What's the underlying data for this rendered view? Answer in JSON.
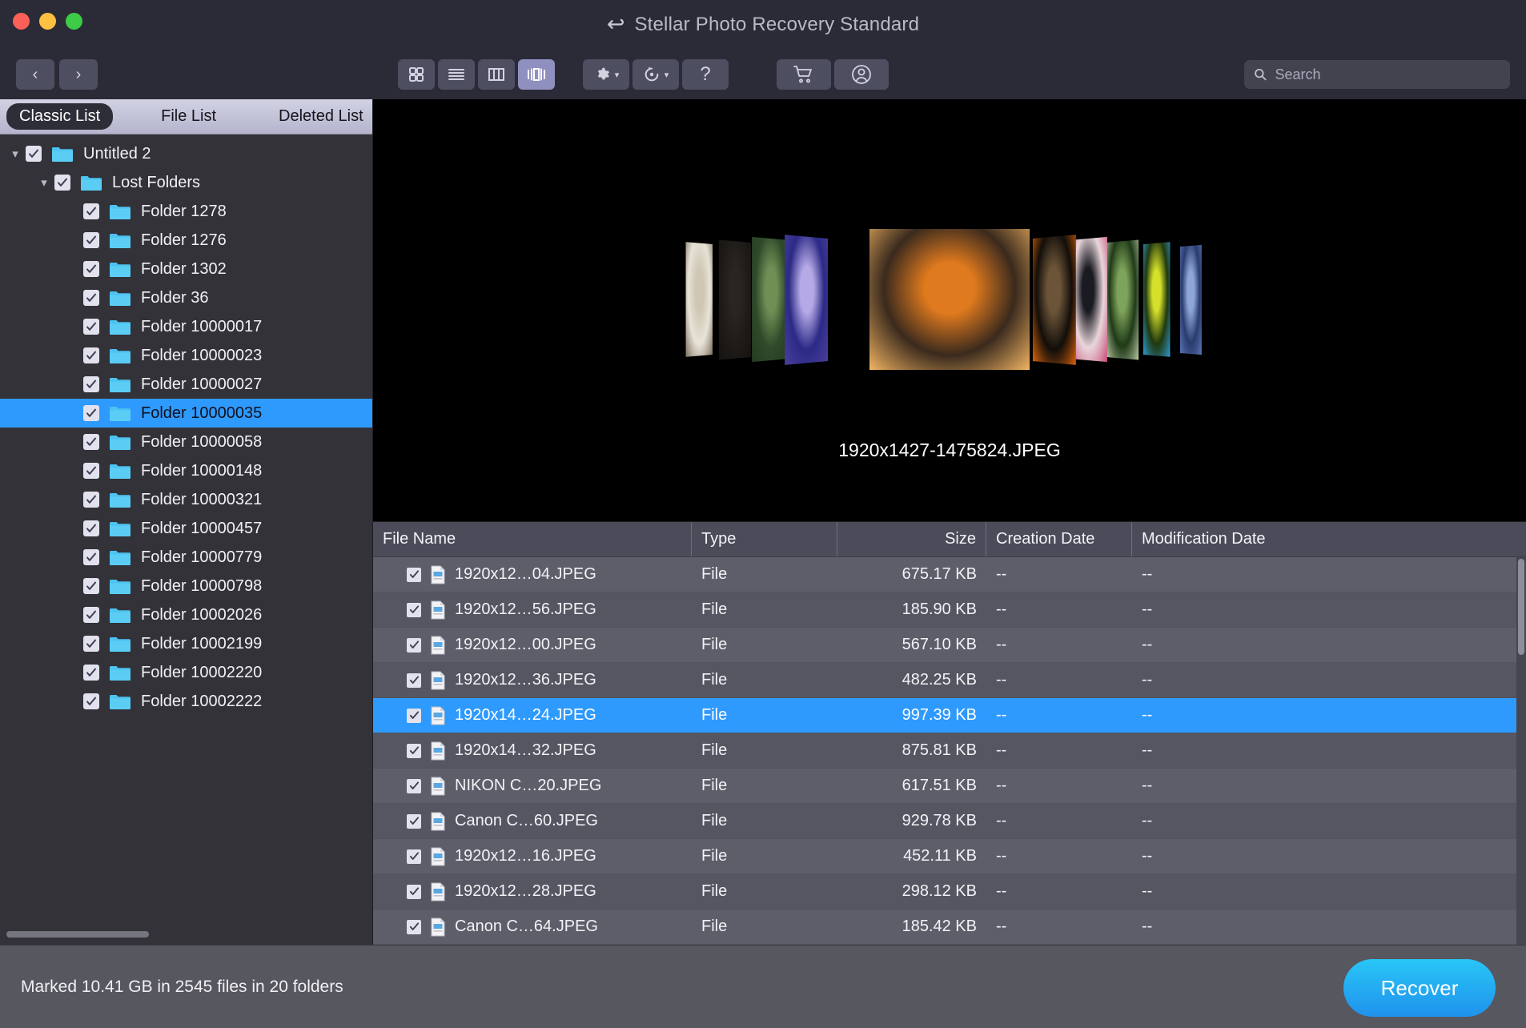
{
  "window": {
    "title": "Stellar Photo Recovery Standard",
    "back_icon": "back-arrow-icon",
    "traffic_lights": {
      "close": "#fc6058",
      "minimize": "#fec041",
      "zoom": "#3ecb46"
    }
  },
  "toolbar": {
    "nav": [
      {
        "name": "back-button",
        "glyph": "‹"
      },
      {
        "name": "forward-button",
        "glyph": "›"
      }
    ],
    "view_modes": [
      {
        "name": "icon-view-button",
        "icon": "grid-icon",
        "active": false
      },
      {
        "name": "list-view-button",
        "icon": "list-icon",
        "active": false
      },
      {
        "name": "column-view-button",
        "icon": "columns-icon",
        "active": false
      },
      {
        "name": "coverflow-view-button",
        "icon": "coverflow-icon",
        "active": true
      }
    ],
    "actions": [
      {
        "name": "settings-button",
        "icon": "gear-icon",
        "has_caret": true
      },
      {
        "name": "history-button",
        "icon": "clock-rewind-icon",
        "has_caret": true
      },
      {
        "name": "help-button",
        "icon": "question-mark-icon",
        "glyph": "?",
        "has_caret": false
      }
    ],
    "account": [
      {
        "name": "cart-button",
        "icon": "shopping-cart-icon"
      },
      {
        "name": "account-button",
        "icon": "user-circle-icon"
      }
    ],
    "search": {
      "placeholder": "Search",
      "value": "",
      "icon": "search-icon"
    }
  },
  "sidebar": {
    "tabs": [
      {
        "label": "Classic List",
        "active": true
      },
      {
        "label": "File List",
        "active": false
      },
      {
        "label": "Deleted List",
        "active": false
      }
    ],
    "tree": [
      {
        "label": "Untitled 2",
        "depth": 0,
        "checked": true,
        "expanded": true,
        "selected": false
      },
      {
        "label": "Lost Folders",
        "depth": 1,
        "checked": true,
        "expanded": true,
        "selected": false
      },
      {
        "label": "Folder 1278",
        "depth": 2,
        "checked": true,
        "expanded": null,
        "selected": false
      },
      {
        "label": "Folder 1276",
        "depth": 2,
        "checked": true,
        "expanded": null,
        "selected": false
      },
      {
        "label": "Folder 1302",
        "depth": 2,
        "checked": true,
        "expanded": null,
        "selected": false
      },
      {
        "label": "Folder 36",
        "depth": 2,
        "checked": true,
        "expanded": null,
        "selected": false
      },
      {
        "label": "Folder 10000017",
        "depth": 2,
        "checked": true,
        "expanded": null,
        "selected": false
      },
      {
        "label": "Folder 10000023",
        "depth": 2,
        "checked": true,
        "expanded": null,
        "selected": false
      },
      {
        "label": "Folder 10000027",
        "depth": 2,
        "checked": true,
        "expanded": null,
        "selected": false
      },
      {
        "label": "Folder 10000035",
        "depth": 2,
        "checked": true,
        "expanded": null,
        "selected": true
      },
      {
        "label": "Folder 10000058",
        "depth": 2,
        "checked": true,
        "expanded": null,
        "selected": false
      },
      {
        "label": "Folder 10000148",
        "depth": 2,
        "checked": true,
        "expanded": null,
        "selected": false
      },
      {
        "label": "Folder 10000321",
        "depth": 2,
        "checked": true,
        "expanded": null,
        "selected": false
      },
      {
        "label": "Folder 10000457",
        "depth": 2,
        "checked": true,
        "expanded": null,
        "selected": false
      },
      {
        "label": "Folder 10000779",
        "depth": 2,
        "checked": true,
        "expanded": null,
        "selected": false
      },
      {
        "label": "Folder 10000798",
        "depth": 2,
        "checked": true,
        "expanded": null,
        "selected": false
      },
      {
        "label": "Folder 10002026",
        "depth": 2,
        "checked": true,
        "expanded": null,
        "selected": false
      },
      {
        "label": "Folder 10002199",
        "depth": 2,
        "checked": true,
        "expanded": null,
        "selected": false
      },
      {
        "label": "Folder 10002220",
        "depth": 2,
        "checked": true,
        "expanded": null,
        "selected": false
      },
      {
        "label": "Folder 10002222",
        "depth": 2,
        "checked": true,
        "expanded": null,
        "selected": false
      }
    ]
  },
  "preview": {
    "caption": "1920x1427-1475824.JPEG",
    "background": "#000000",
    "covers": [
      {
        "name": "cover-rabbit",
        "position": -4
      },
      {
        "name": "cover-dark",
        "position": -3
      },
      {
        "name": "cover-cactus",
        "position": -2
      },
      {
        "name": "cover-polarbear",
        "position": -1
      },
      {
        "name": "cover-cat",
        "position": 0
      },
      {
        "name": "cover-owl",
        "position": 1
      },
      {
        "name": "cover-dog",
        "position": 2
      },
      {
        "name": "cover-bird",
        "position": 3
      },
      {
        "name": "cover-frog",
        "position": 4
      },
      {
        "name": "cover-flower",
        "position": 5
      }
    ]
  },
  "file_table": {
    "columns": [
      "File Name",
      "Type",
      "Size",
      "Creation Date",
      "Modification Date"
    ],
    "rows": [
      {
        "checked": true,
        "name": "1920x12…04.JPEG",
        "type": "File",
        "size": "675.17 KB",
        "creation": "--",
        "modification": "--",
        "selected": false
      },
      {
        "checked": true,
        "name": "1920x12…56.JPEG",
        "type": "File",
        "size": "185.90 KB",
        "creation": "--",
        "modification": "--",
        "selected": false
      },
      {
        "checked": true,
        "name": "1920x12…00.JPEG",
        "type": "File",
        "size": "567.10 KB",
        "creation": "--",
        "modification": "--",
        "selected": false
      },
      {
        "checked": true,
        "name": "1920x12…36.JPEG",
        "type": "File",
        "size": "482.25 KB",
        "creation": "--",
        "modification": "--",
        "selected": false
      },
      {
        "checked": true,
        "name": "1920x14…24.JPEG",
        "type": "File",
        "size": "997.39 KB",
        "creation": "--",
        "modification": "--",
        "selected": true
      },
      {
        "checked": true,
        "name": "1920x14…32.JPEG",
        "type": "File",
        "size": "875.81 KB",
        "creation": "--",
        "modification": "--",
        "selected": false
      },
      {
        "checked": true,
        "name": "NIKON C…20.JPEG",
        "type": "File",
        "size": "617.51 KB",
        "creation": "--",
        "modification": "--",
        "selected": false
      },
      {
        "checked": true,
        "name": "Canon C…60.JPEG",
        "type": "File",
        "size": "929.78 KB",
        "creation": "--",
        "modification": "--",
        "selected": false
      },
      {
        "checked": true,
        "name": "1920x12…16.JPEG",
        "type": "File",
        "size": "452.11 KB",
        "creation": "--",
        "modification": "--",
        "selected": false
      },
      {
        "checked": true,
        "name": "1920x12…28.JPEG",
        "type": "File",
        "size": "298.12 KB",
        "creation": "--",
        "modification": "--",
        "selected": false
      },
      {
        "checked": true,
        "name": "Canon C…64.JPEG",
        "type": "File",
        "size": "185.42 KB",
        "creation": "--",
        "modification": "--",
        "selected": false
      }
    ]
  },
  "statusbar": {
    "status": "Marked 10.41 GB in 2545 files in 20 folders",
    "recover_label": "Recover",
    "accent": "#1f92ec"
  }
}
